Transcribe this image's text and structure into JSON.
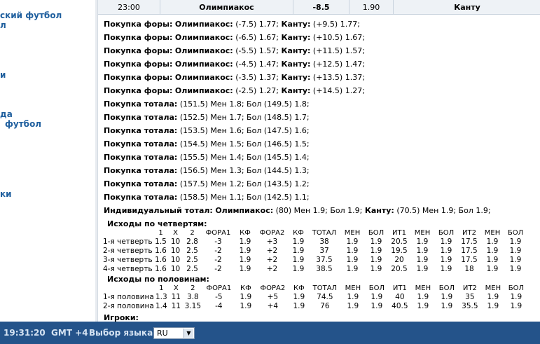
{
  "sidebar": {
    "links": [
      "ский футбол",
      "л",
      "и",
      "да",
      "футбол",
      "ки"
    ]
  },
  "match": {
    "time": "23:00",
    "team1": "Олимпиакос",
    "handicap": "-8.5",
    "odd": "1.90",
    "team2": "Канту"
  },
  "handicap_lines": [
    {
      "label": "Покупка форы:",
      "t1": "Олимпиакос:",
      "v1": "(-7.5) 1.77;",
      "t2": "Канту:",
      "v2": "(+9.5) 1.77;"
    },
    {
      "label": "Покупка форы:",
      "t1": "Олимпиакос:",
      "v1": "(-6.5) 1.67;",
      "t2": "Канту:",
      "v2": "(+10.5) 1.67;"
    },
    {
      "label": "Покупка форы:",
      "t1": "Олимпиакос:",
      "v1": "(-5.5) 1.57;",
      "t2": "Канту:",
      "v2": "(+11.5) 1.57;"
    },
    {
      "label": "Покупка форы:",
      "t1": "Олимпиакос:",
      "v1": "(-4.5) 1.47;",
      "t2": "Канту:",
      "v2": "(+12.5) 1.47;"
    },
    {
      "label": "Покупка форы:",
      "t1": "Олимпиакос:",
      "v1": "(-3.5) 1.37;",
      "t2": "Канту:",
      "v2": "(+13.5) 1.37;"
    },
    {
      "label": "Покупка форы:",
      "t1": "Олимпиакос:",
      "v1": "(-2.5) 1.27;",
      "t2": "Канту:",
      "v2": "(+14.5) 1.27;"
    }
  ],
  "total_lines": [
    {
      "label": "Покупка тотала:",
      "text": "(151.5) Мен 1.8; Бол (149.5) 1.8;"
    },
    {
      "label": "Покупка тотала:",
      "text": "(152.5) Мен 1.7; Бол (148.5) 1.7;"
    },
    {
      "label": "Покупка тотала:",
      "text": "(153.5) Мен 1.6; Бол (147.5) 1.6;"
    },
    {
      "label": "Покупка тотала:",
      "text": "(154.5) Мен 1.5; Бол (146.5) 1.5;"
    },
    {
      "label": "Покупка тотала:",
      "text": "(155.5) Мен 1.4; Бол (145.5) 1.4;"
    },
    {
      "label": "Покупка тотала:",
      "text": "(156.5) Мен 1.3; Бол (144.5) 1.3;"
    },
    {
      "label": "Покупка тотала:",
      "text": "(157.5) Мен 1.2; Бол (143.5) 1.2;"
    },
    {
      "label": "Покупка тотала:",
      "text": "(158.5) Мен 1.1; Бол (142.5) 1.1;"
    }
  ],
  "individual_total": {
    "label": "Индивидуальный тотал:",
    "t1": "Олимпиакос:",
    "v1": "(80) Мен 1.9; Бол 1.9;",
    "t2": "Канту:",
    "v2": "(70.5) Мен 1.9; Бол 1.9;"
  },
  "quarters": {
    "title": "Исходы по четвертям:",
    "headers": [
      "",
      "1",
      "X",
      "2",
      "ФОРА1",
      "КФ",
      "ФОРА2",
      "КФ",
      "ТОТАЛ",
      "МЕН",
      "БОЛ",
      "ИТ1",
      "МЕН",
      "БОЛ",
      "ИТ2",
      "МЕН",
      "БОЛ"
    ],
    "rows": [
      [
        "1-я четверть",
        "1.5",
        "10",
        "2.8",
        "-3",
        "1.9",
        "+3",
        "1.9",
        "38",
        "1.9",
        "1.9",
        "20.5",
        "1.9",
        "1.9",
        "17.5",
        "1.9",
        "1.9"
      ],
      [
        "2-я четверть",
        "1.6",
        "10",
        "2.5",
        "-2",
        "1.9",
        "+2",
        "1.9",
        "37",
        "1.9",
        "1.9",
        "19.5",
        "1.9",
        "1.9",
        "17.5",
        "1.9",
        "1.9"
      ],
      [
        "3-я четверть",
        "1.6",
        "10",
        "2.5",
        "-2",
        "1.9",
        "+2",
        "1.9",
        "37.5",
        "1.9",
        "1.9",
        "20",
        "1.9",
        "1.9",
        "17.5",
        "1.9",
        "1.9"
      ],
      [
        "4-я четверть",
        "1.6",
        "10",
        "2.5",
        "-2",
        "1.9",
        "+2",
        "1.9",
        "38.5",
        "1.9",
        "1.9",
        "20.5",
        "1.9",
        "1.9",
        "18",
        "1.9",
        "1.9"
      ]
    ]
  },
  "halves": {
    "title": "Исходы по половинам:",
    "headers": [
      "",
      "1",
      "X",
      "2",
      "ФОРА1",
      "КФ",
      "ФОРА2",
      "КФ",
      "ТОТАЛ",
      "МЕН",
      "БОЛ",
      "ИТ1",
      "МЕН",
      "БОЛ",
      "ИТ2",
      "МЕН",
      "БОЛ"
    ],
    "rows": [
      [
        "1-я половина",
        "1.3",
        "11",
        "3.8",
        "-5",
        "1.9",
        "+5",
        "1.9",
        "74.5",
        "1.9",
        "1.9",
        "40",
        "1.9",
        "1.9",
        "35",
        "1.9",
        "1.9"
      ],
      [
        "2-я половина",
        "1.4",
        "11",
        "3.15",
        "-4",
        "1.9",
        "+4",
        "1.9",
        "76",
        "1.9",
        "1.9",
        "40.5",
        "1.9",
        "1.9",
        "35.5",
        "1.9",
        "1.9"
      ]
    ]
  },
  "players_label": "Игроки:",
  "footer": {
    "clock": "19:31:20  GMT +4",
    "language_label": "Выбор языка:",
    "language_value": "RU",
    "dropdown_icon": "chevron-down-icon"
  },
  "colors": {
    "footer_bg": "#24538a",
    "sidebar_link": "#1f5f9e"
  }
}
